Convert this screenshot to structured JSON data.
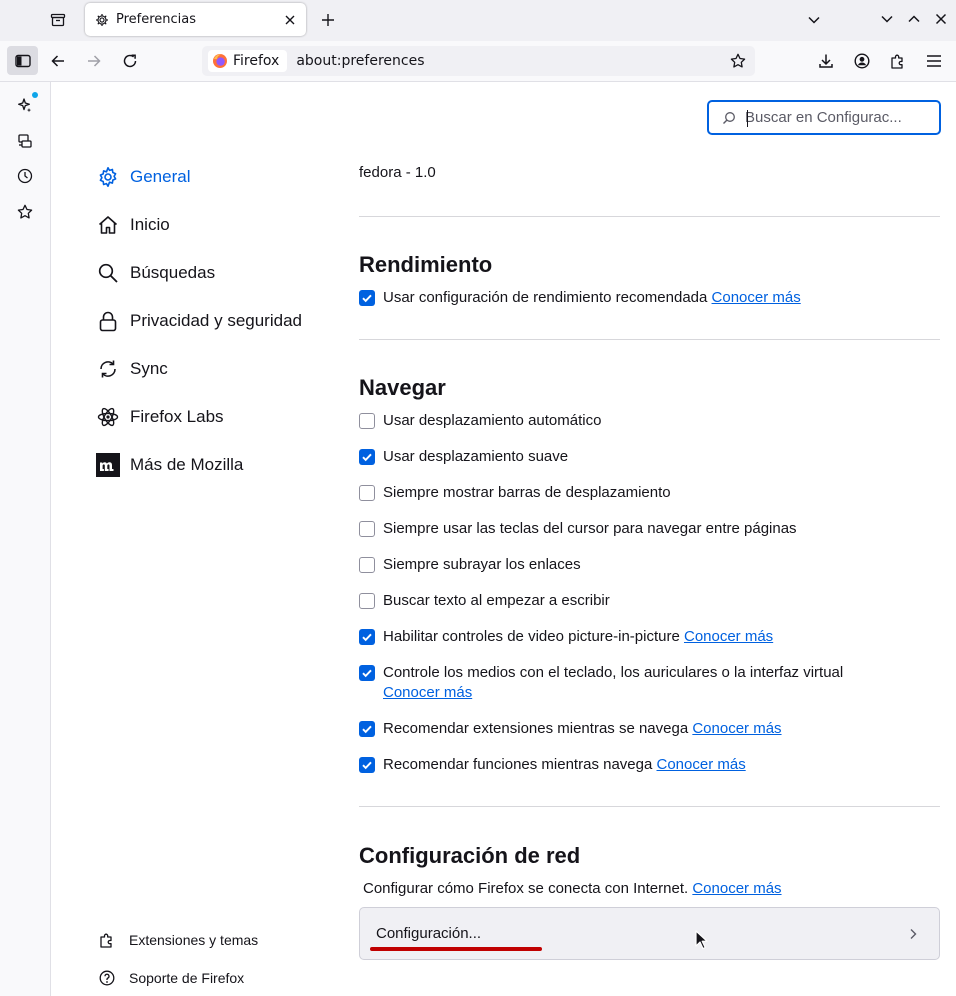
{
  "tab": {
    "title": "Preferencias"
  },
  "urlbar": {
    "identity_label": "Firefox",
    "url": "about:preferences"
  },
  "search": {
    "placeholder": "Buscar en Configurac..."
  },
  "categories": [
    {
      "label": "General",
      "icon": "gear-icon",
      "selected": true
    },
    {
      "label": "Inicio",
      "icon": "home-icon"
    },
    {
      "label": "Búsquedas",
      "icon": "search-icon"
    },
    {
      "label": "Privacidad y seguridad",
      "icon": "lock-icon"
    },
    {
      "label": "Sync",
      "icon": "sync-icon"
    },
    {
      "label": "Firefox Labs",
      "icon": "atom-icon"
    },
    {
      "label": "Más de Mozilla",
      "icon": "mozilla-icon"
    }
  ],
  "footer": {
    "extensions": "Extensiones y temas",
    "support": "Soporte de Firefox"
  },
  "version_text": "fedora - 1.0",
  "performance": {
    "heading": "Rendimiento",
    "recommended": {
      "label": "Usar configuración de rendimiento recomendada",
      "checked": true,
      "link": "Conocer más"
    }
  },
  "browsing": {
    "heading": "Navegar",
    "options": [
      {
        "label": "Usar desplazamiento automático",
        "checked": false
      },
      {
        "label": "Usar desplazamiento suave",
        "checked": true
      },
      {
        "label": "Siempre mostrar barras de desplazamiento",
        "checked": false
      },
      {
        "label": "Siempre usar las teclas del cursor para navegar entre páginas",
        "checked": false
      },
      {
        "label": "Siempre subrayar los enlaces",
        "checked": false
      },
      {
        "label": "Buscar texto al empezar a escribir",
        "checked": false
      },
      {
        "label": "Habilitar controles de video picture-in-picture",
        "checked": true,
        "link": "Conocer más"
      },
      {
        "label": "Controle los medios con el teclado, los auriculares o la interfaz virtual",
        "checked": true,
        "link": "Conocer más"
      },
      {
        "label": "Recomendar extensiones mientras se navega",
        "checked": true,
        "link": "Conocer más"
      },
      {
        "label": "Recomendar funciones mientras navega",
        "checked": true,
        "link": "Conocer más"
      }
    ]
  },
  "network": {
    "heading": "Configuración de red",
    "description": "Configurar cómo Firefox se conecta con Internet.",
    "link": "Conocer más",
    "button": "Configuración..."
  },
  "colors": {
    "accent": "#0061e0",
    "annotation": "#c00000"
  }
}
